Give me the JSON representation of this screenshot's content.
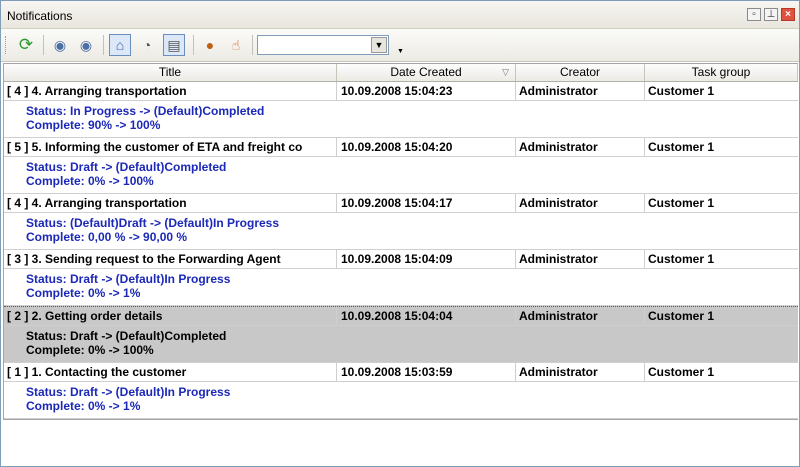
{
  "window": {
    "title": "Notifications"
  },
  "columns": {
    "title": "Title",
    "date": "Date Created",
    "creator": "Creator",
    "group": "Task group"
  },
  "rows": [
    {
      "title": "[ 4 ] 4. Arranging transportation",
      "date": "10.09.2008 15:04:23",
      "creator": "Administrator",
      "group": "Customer 1",
      "status": "Status: In Progress -> (Default)Completed",
      "complete": "Complete: 90% -> 100%"
    },
    {
      "title": "[ 5 ] 5. Informing the customer of ETA and freight co",
      "date": "10.09.2008 15:04:20",
      "creator": "Administrator",
      "group": "Customer 1",
      "status": "Status: Draft -> (Default)Completed",
      "complete": "Complete: 0% -> 100%"
    },
    {
      "title": "[ 4 ] 4. Arranging transportation",
      "date": "10.09.2008 15:04:17",
      "creator": "Administrator",
      "group": "Customer 1",
      "status": "Status: (Default)Draft -> (Default)In Progress",
      "complete": "Complete: 0,00 % -> 90,00 %"
    },
    {
      "title": "[ 3 ] 3. Sending request to the Forwarding Agent",
      "date": "10.09.2008 15:04:09",
      "creator": "Administrator",
      "group": "Customer 1",
      "status": "Status: Draft -> (Default)In Progress",
      "complete": "Complete: 0% -> 1%"
    },
    {
      "title": "[ 2 ] 2. Getting order details",
      "date": "10.09.2008 15:04:04",
      "creator": "Administrator",
      "group": "Customer 1",
      "status": "Status: Draft -> (Default)Completed",
      "complete": "Complete: 0% -> 100%",
      "selected": true
    },
    {
      "title": "[ 1 ] 1. Contacting the customer",
      "date": "10.09.2008 15:03:59",
      "creator": "Administrator",
      "group": "Customer 1",
      "status": "Status: Draft -> (Default)In Progress",
      "complete": "Complete: 0% -> 1%"
    }
  ],
  "toolbar": {
    "combo_value": ""
  },
  "icons": [
    "refresh-icon",
    "mark-read-icon",
    "mark-all-read-icon",
    "show-read-icon",
    "filter-icon",
    "properties-icon",
    "clear-icon",
    "touch-icon"
  ]
}
